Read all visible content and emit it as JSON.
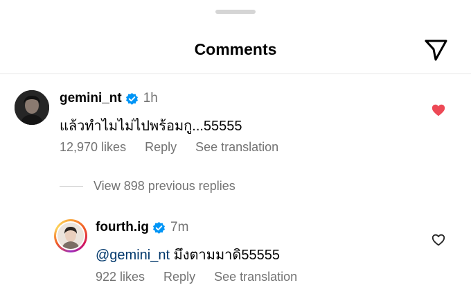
{
  "header": {
    "title": "Comments"
  },
  "comment": {
    "username": "gemini_nt",
    "time": "1h",
    "text": "แล้วทำไมไม่ไปพร้อมกู...55555",
    "likes": "12,970 likes",
    "reply_label": "Reply",
    "translate_label": "See translation",
    "liked": true,
    "heart_color": "#ed4956"
  },
  "view_replies": {
    "label": "View 898 previous replies"
  },
  "reply": {
    "username": "fourth.ig",
    "time": "7m",
    "mention": "@gemini_nt",
    "text": " มึงตามมาดิ55555",
    "likes": "922 likes",
    "reply_label": "Reply",
    "translate_label": "See translation",
    "liked": false
  },
  "colors": {
    "verified": "#0095f6",
    "secondary_text": "#737373",
    "mention": "#00376b"
  },
  "icons": {
    "share": "paper-plane-icon",
    "verified": "verified-badge-icon",
    "heart_filled": "heart-filled-icon",
    "heart_outline": "heart-outline-icon"
  }
}
